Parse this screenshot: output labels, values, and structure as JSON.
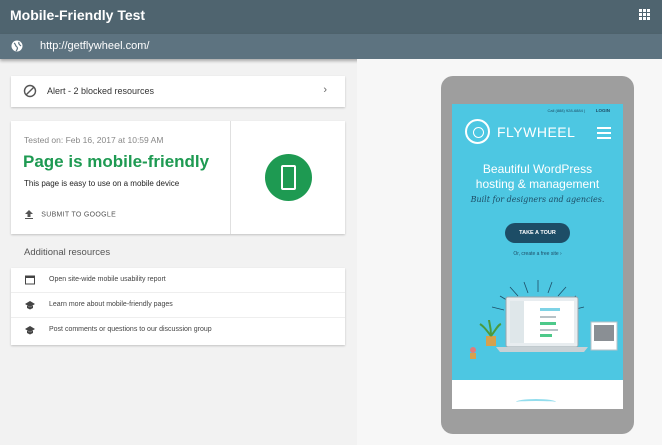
{
  "app": {
    "title": "Mobile-Friendly Test",
    "icons": {
      "apps": "apps-grid-icon",
      "globe": "globe-icon"
    }
  },
  "urlbar": {
    "url": "http://getflywheel.com/"
  },
  "alert": {
    "text": "Alert - 2 blocked resources",
    "chevron": "›"
  },
  "result": {
    "tested": "Tested on: Feb 16, 2017 at 10:59 AM",
    "verdict": "Page is mobile-friendly",
    "description": "This page is easy to use on a mobile device",
    "submit_label": "SUBMIT TO GOOGLE",
    "verdict_color": "#1e9a52"
  },
  "additional": {
    "heading": "Additional resources",
    "items": [
      {
        "label": "Open site-wide mobile usability report",
        "icon": "report-icon"
      },
      {
        "label": "Learn more about mobile-friendly pages",
        "icon": "school-icon"
      },
      {
        "label": "Post comments or questions to our discussion group",
        "icon": "school-icon"
      }
    ]
  },
  "preview": {
    "call": "Call (888) 928-6884 |",
    "login": "LOGIN",
    "logo_text": "FLYWHEEL",
    "headline_1": "Beautiful WordPress",
    "headline_2": "hosting & management",
    "subheadline": "Built for designers and agencies.",
    "cta": "TAKE A TOUR",
    "secondary": "Or, create a free site ›",
    "brand_color": "#4dc7e2",
    "dark_color": "#1d4d66"
  }
}
